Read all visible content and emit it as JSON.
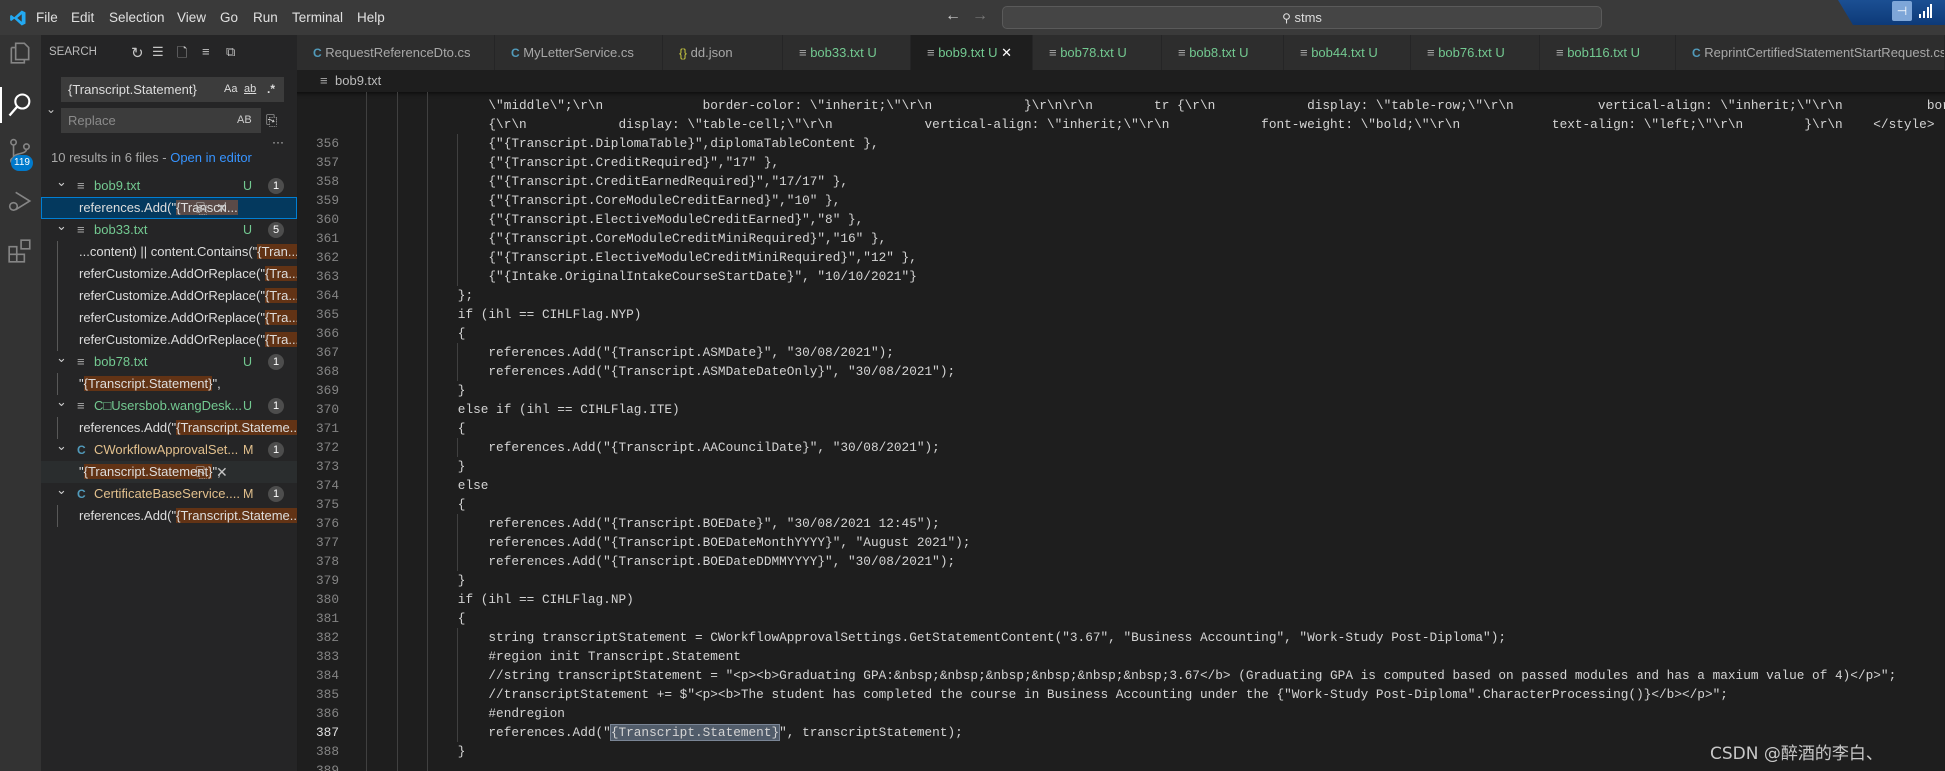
{
  "titlebar": {
    "menu": [
      "File",
      "Edit",
      "Selection",
      "View",
      "Go",
      "Run",
      "Terminal",
      "Help"
    ],
    "search": "stms"
  },
  "activity": {
    "source_control_badge": "119"
  },
  "sidebar": {
    "title": "SEARCH",
    "search_value": "{Transcript.Statement}",
    "replace_placeholder": "Replace",
    "match_case": "Aa",
    "whole_word": "ab",
    "regex": ".*",
    "preserve_case": "AB",
    "more": "···",
    "summary": "10 results in 6 files - ",
    "open_in_editor": "Open in editor",
    "groups": [
      {
        "name": "bob9.txt",
        "status": "U",
        "count": "1",
        "icon": "txt",
        "matches": [
          {
            "pre": "references.Add(\"",
            "match": "{Transcri...",
            "post": "",
            "state": "selected"
          }
        ]
      },
      {
        "name": "bob33.txt",
        "status": "U",
        "count": "5",
        "icon": "txt",
        "matches": [
          {
            "pre": "...content) || content.Contains(\"",
            "match": "{Tran...",
            "post": ""
          },
          {
            "pre": "referCustomize.AddOrReplace(\"",
            "match": "{Tra...",
            "post": ""
          },
          {
            "pre": "referCustomize.AddOrReplace(\"",
            "match": "{Tra...",
            "post": ""
          },
          {
            "pre": "referCustomize.AddOrReplace(\"",
            "match": "{Tra...",
            "post": ""
          },
          {
            "pre": "referCustomize.AddOrReplace(\"",
            "match": "{Tra...",
            "post": ""
          }
        ]
      },
      {
        "name": "bob78.txt",
        "status": "U",
        "count": "1",
        "icon": "txt",
        "matches": [
          {
            "pre": "\"",
            "match": "{Transcript.Statement}",
            "post": "\","
          }
        ]
      },
      {
        "name": "C□Usersbob.wangDesk...",
        "status": "U",
        "count": "1",
        "icon": "txt",
        "matches": [
          {
            "pre": "references.Add(\"",
            "match": "{Transcript.Stateme...",
            "post": ""
          }
        ]
      },
      {
        "name": "CWorkflowApprovalSet...",
        "status": "M",
        "count": "1",
        "icon": "cs",
        "matches": [
          {
            "pre": "\"",
            "match": "{Transcript.Statement}",
            "post": "\",",
            "state": "hover"
          }
        ]
      },
      {
        "name": "CertificateBaseService....",
        "status": "M",
        "count": "1",
        "icon": "cs",
        "matches": [
          {
            "pre": "references.Add(\"",
            "match": "{Transcript.Stateme...",
            "post": ""
          }
        ]
      }
    ]
  },
  "tabs": [
    {
      "label": "RequestReferenceDto.cs",
      "icon": "cs",
      "status": ""
    },
    {
      "label": "MyLetterService.cs",
      "icon": "cs",
      "status": ""
    },
    {
      "label": "dd.json",
      "icon": "json",
      "status": ""
    },
    {
      "label": "bob33.txt",
      "icon": "txt",
      "status": "U"
    },
    {
      "label": "bob9.txt",
      "icon": "txt",
      "status": "U",
      "active": true
    },
    {
      "label": "bob78.txt",
      "icon": "txt",
      "status": "U"
    },
    {
      "label": "bob8.txt",
      "icon": "txt",
      "status": "U"
    },
    {
      "label": "bob44.txt",
      "icon": "txt",
      "status": "U"
    },
    {
      "label": "bob76.txt",
      "icon": "txt",
      "status": "U"
    },
    {
      "label": "bob116.txt",
      "icon": "txt",
      "status": "U"
    },
    {
      "label": "ReprintCertifiedStatementStartRequest.cs",
      "icon": "cs",
      "status": ""
    }
  ],
  "breadcrumb": "bob9.txt",
  "editor": {
    "current_line": "387",
    "lines": [
      {
        "n": "",
        "i": 16,
        "t": "\\\"middle\\\";\\r\\n             border-color: \\\"inherit;\\\"\\r\\n            }\\r\\n\\r\\n        tr {\\r\\n            display: \\\"table-row;\\\"\\r\\n           vertical-align: \\\"inherit;\\\"\\r\\n           borde"
      },
      {
        "n": "",
        "i": 16,
        "t": "{\\r\\n            display: \\\"table-cell;\\\"\\r\\n            vertical-align: \\\"inherit;\\\"\\r\\n            font-weight: \\\"bold;\\\"\\r\\n            text-align: \\\"left;\\\"\\r\\n        }\\r\\n    </style>"
      },
      {
        "n": "356",
        "i": 16,
        "t": "{\"{Transcript.DiplomaTable}\",diplomaTableContent },"
      },
      {
        "n": "357",
        "i": 16,
        "t": "{\"{Transcript.CreditRequired}\",\"17\" },"
      },
      {
        "n": "358",
        "i": 16,
        "t": "{\"{Transcript.CreditEarnedRequired}\",\"17/17\" },"
      },
      {
        "n": "359",
        "i": 16,
        "t": "{\"{Transcript.CoreModuleCreditEarned}\",\"10\" },"
      },
      {
        "n": "360",
        "i": 16,
        "t": "{\"{Transcript.ElectiveModuleCreditEarned}\",\"8\" },"
      },
      {
        "n": "361",
        "i": 16,
        "t": "{\"{Transcript.CoreModuleCreditMiniRequired}\",\"16\" },"
      },
      {
        "n": "362",
        "i": 16,
        "t": "{\"{Transcript.ElectiveModuleCreditMiniRequired}\",\"12\" },"
      },
      {
        "n": "363",
        "i": 16,
        "t": "{\"{Intake.OriginalIntakeCourseStartDate}\", \"10/10/2021\"}"
      },
      {
        "n": "364",
        "i": 12,
        "t": "};"
      },
      {
        "n": "365",
        "i": 12,
        "t": "if (ihl == CIHLFlag.NYP)"
      },
      {
        "n": "366",
        "i": 12,
        "t": "{"
      },
      {
        "n": "367",
        "i": 16,
        "t": "references.Add(\"{Transcript.ASMDate}\", \"30/08/2021\");"
      },
      {
        "n": "368",
        "i": 16,
        "t": "references.Add(\"{Transcript.ASMDateDateOnly}\", \"30/08/2021\");"
      },
      {
        "n": "369",
        "i": 12,
        "t": "}"
      },
      {
        "n": "370",
        "i": 12,
        "t": "else if (ihl == CIHLFlag.ITE)"
      },
      {
        "n": "371",
        "i": 12,
        "t": "{"
      },
      {
        "n": "372",
        "i": 16,
        "t": "references.Add(\"{Transcript.AACouncilDate}\", \"30/08/2021\");"
      },
      {
        "n": "373",
        "i": 12,
        "t": "}"
      },
      {
        "n": "374",
        "i": 12,
        "t": "else"
      },
      {
        "n": "375",
        "i": 12,
        "t": "{"
      },
      {
        "n": "376",
        "i": 16,
        "t": "references.Add(\"{Transcript.BOEDate}\", \"30/08/2021 12:45\");"
      },
      {
        "n": "377",
        "i": 16,
        "t": "references.Add(\"{Transcript.BOEDateMonthYYYY}\", \"August 2021\");"
      },
      {
        "n": "378",
        "i": 16,
        "t": "references.Add(\"{Transcript.BOEDateDDMMYYYY}\", \"30/08/2021\");"
      },
      {
        "n": "379",
        "i": 12,
        "t": "}"
      },
      {
        "n": "380",
        "i": 12,
        "t": "if (ihl == CIHLFlag.NP)"
      },
      {
        "n": "381",
        "i": 12,
        "t": "{"
      },
      {
        "n": "382",
        "i": 16,
        "t": "string transcriptStatement = CWorkflowApprovalSettings.GetStatementContent(\"3.67\", \"Business Accounting\", \"Work-Study Post-Diploma\");"
      },
      {
        "n": "383",
        "i": 16,
        "t": "#region init Transcript.Statement"
      },
      {
        "n": "384",
        "i": 16,
        "t": "//string transcriptStatement = \"<p><b>Graduating GPA:&nbsp;&nbsp;&nbsp;&nbsp;&nbsp;&nbsp;3.67</b> (Graduating GPA is computed based on passed modules and has a maxium value of 4)</p>\";"
      },
      {
        "n": "385",
        "i": 16,
        "t": "//transcriptStatement += $\"<p><b>The student has completed the course in Business Accounting under the {\"Work-Study Post-Diploma\".CharacterProcessing()}</b></p>\";"
      },
      {
        "n": "386",
        "i": 16,
        "t": "#endregion"
      },
      {
        "n": "387",
        "i": 16,
        "t": "references.Add(\"",
        "m": "{Transcript.Statement}",
        "a": "\", transcriptStatement);"
      },
      {
        "n": "388",
        "i": 12,
        "t": "}"
      },
      {
        "n": "389",
        "i": 12,
        "t": ""
      }
    ]
  },
  "watermark": "CSDN @醉酒的李白、",
  "colors": {
    "accent": "#007acc",
    "untracked": "#73c991",
    "modified": "#e2c08d",
    "match_bg": "#623315"
  }
}
